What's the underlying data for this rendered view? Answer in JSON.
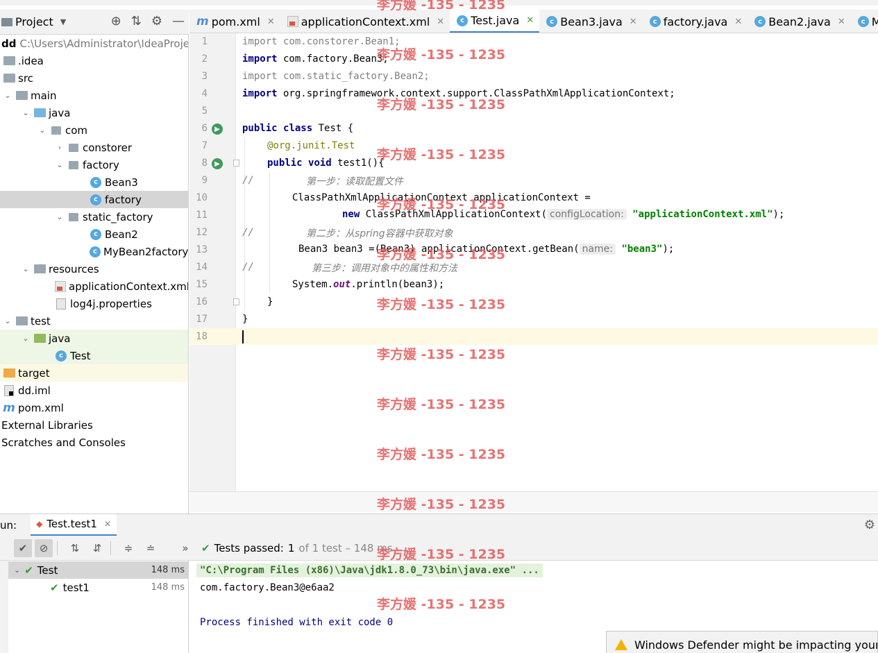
{
  "project_panel": {
    "title": "Project",
    "root_name": "dd",
    "root_path": "C:\\Users\\Administrator\\IdeaProje",
    "items": [
      {
        "label": ".idea"
      },
      {
        "label": "src"
      },
      {
        "label": "main"
      },
      {
        "label": "java"
      },
      {
        "label": "com"
      },
      {
        "label": "constorer"
      },
      {
        "label": "factory"
      },
      {
        "label": "Bean3"
      },
      {
        "label": "factory"
      },
      {
        "label": "static_factory"
      },
      {
        "label": "Bean2"
      },
      {
        "label": "MyBean2factory"
      },
      {
        "label": "resources"
      },
      {
        "label": "applicationContext.xml"
      },
      {
        "label": "log4j.properties"
      },
      {
        "label": "test"
      },
      {
        "label": "java"
      },
      {
        "label": "Test"
      },
      {
        "label": "target"
      },
      {
        "label": "dd.iml"
      },
      {
        "label": "pom.xml"
      },
      {
        "label": "External Libraries"
      },
      {
        "label": "Scratches and Consoles"
      }
    ]
  },
  "tabs": [
    {
      "label": "pom.xml"
    },
    {
      "label": "applicationContext.xml"
    },
    {
      "label": "Test.java"
    },
    {
      "label": "Bean3.java"
    },
    {
      "label": "factory.java"
    },
    {
      "label": "Bean2.java"
    },
    {
      "label": "MyBea"
    }
  ],
  "editor": {
    "line_numbers": [
      "1",
      "2",
      "3",
      "4",
      "5",
      "6",
      "7",
      "8",
      "9",
      "10",
      "11",
      "12",
      "13",
      "14",
      "15",
      "16",
      "17",
      "18"
    ],
    "code": {
      "l1_kw": "import",
      "l1_rest": " com.constorer.Bean1;",
      "l2_kw": "import",
      "l2_rest": " com.factory.Bean3;",
      "l3_kw": "import",
      "l3_rest": " com.static_factory.Bean2;",
      "l4_kw": "import",
      "l4_rest": " org.springframework.context.support.ClassPathXmlApplicationContext;",
      "l6_kw1": "public",
      "l6_kw2": "class",
      "l6_rest": " Test {",
      "l7_ann": "@org.junit.",
      "l7_ann2": "Test",
      "l8_kw1": "public",
      "l8_kw2": "void",
      "l8_rest": " test1(){",
      "l9_slash": "//",
      "l9_cmt": "第一步：读取配置文件",
      "l10": "ClassPathXmlApplicationContext applicationContext =",
      "l11_kw": "new",
      "l11_rest": " ClassPathXmlApplicationContext(",
      "l11_hint": "configLocation:",
      "l11_str": "\"applicationContext.xml\"",
      "l11_end": ");",
      "l12_slash": "//",
      "l12_cmt": "第二步：从spring容器中获取对象",
      "l13_rest": "Bean3 bean3 =(Bean3) applicationContext.getBean(",
      "l13_hint": "name:",
      "l13_str": "\"bean3\"",
      "l13_end": ");",
      "l14_slash": "//",
      "l14_cmt": "第三步：调用对象中的属性和方法",
      "l15_a": "System.",
      "l15_fld": "out",
      "l15_b": ".println(bean3);",
      "l16": "}",
      "l17": "}"
    }
  },
  "run": {
    "label": "un:",
    "tab_label": "Test.test1",
    "status_prefix": "Tests passed:",
    "status_count": "1",
    "status_rest": "of 1 test – 148 ms",
    "tree": [
      {
        "label": "Test",
        "time": "148 ms"
      },
      {
        "label": "test1",
        "time": "148 ms"
      }
    ],
    "console": {
      "command": "\"C:\\Program Files (x86)\\Java\\jdk1.8.0_73\\bin\\java.exe\" ...",
      "output": "com.factory.Bean3@e6aa2",
      "exit": "Process finished with exit code 0"
    }
  },
  "notification": {
    "text": "Windows Defender might be impacting your"
  },
  "watermark": {
    "text": "李方媛 -135 - 1235"
  },
  "colors": {
    "keyword": "#000080",
    "string": "#008000",
    "comment": "#808080",
    "annotation": "#808000",
    "accent": "#4083c9",
    "pass": "#3a9b3a",
    "watermark": "#e55a5a"
  }
}
